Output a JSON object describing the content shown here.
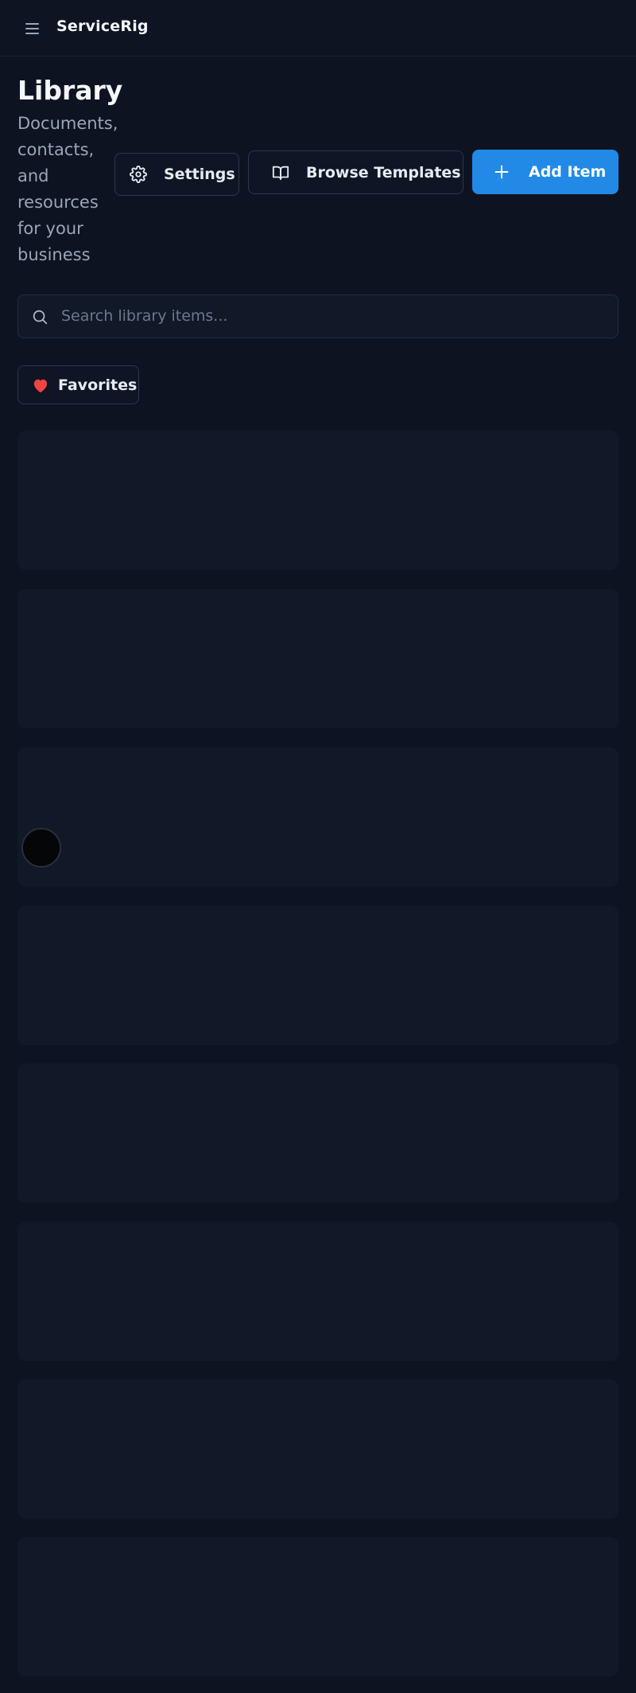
{
  "header": {
    "brand": "ServiceRig",
    "menu_icon": "hamburger-menu-icon"
  },
  "page": {
    "title": "Library",
    "subtitle": "Documents, contacts, and resources for your business"
  },
  "actions": {
    "settings_label": "Settings",
    "settings_icon": "gear-icon",
    "browse_label": "Browse Templates",
    "browse_icon": "open-book-icon",
    "add_label": "Add Item",
    "add_icon": "plus-icon"
  },
  "search": {
    "placeholder": "Search library items...",
    "value": "",
    "icon": "search-icon"
  },
  "filters": {
    "favorites_label": "Favorites",
    "favorites_icon": "heart-icon"
  },
  "colors": {
    "background": "#0d1320",
    "accent": "#2289e6",
    "heart": "#ef4444",
    "card": "#111828"
  }
}
